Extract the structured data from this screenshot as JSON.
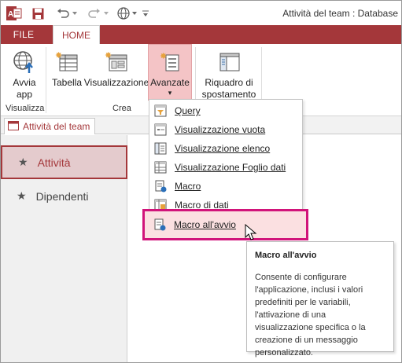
{
  "window": {
    "title": "Attività del team : Database"
  },
  "qat": {
    "app_icon_letter": "A",
    "undo_icon": "undo-icon",
    "redo_icon": "redo-icon",
    "web_icon": "globe-icon",
    "customize_icon": "caret-down-icon"
  },
  "tabs": {
    "file": "FILE",
    "home": "HOME"
  },
  "ribbon": {
    "launch_app": {
      "line1": "Avvia",
      "line2": "app"
    },
    "group_visualizza": "Visualizza",
    "table": "Tabella",
    "view": "Visualizzazione",
    "advanced": "Avanzate",
    "advanced_arrow": "▾",
    "group_crea": "Crea",
    "nav_pane": {
      "line1": "Riquadro di",
      "line2": "spostamento"
    }
  },
  "doc_tab": {
    "label": "Attività del team"
  },
  "nav": {
    "items": [
      {
        "label": "Attività",
        "star": "★"
      },
      {
        "label": "Dipendenti",
        "star": "★"
      }
    ]
  },
  "menu": {
    "items": [
      {
        "label": "Query",
        "icon": "query-icon"
      },
      {
        "label": "Visualizzazione vuota",
        "icon": "blank-view-icon"
      },
      {
        "label": "Visualizzazione elenco",
        "icon": "list-view-icon"
      },
      {
        "label": "Visualizzazione Foglio dati",
        "icon": "datasheet-view-icon"
      },
      {
        "label": "Macro",
        "icon": "macro-icon"
      },
      {
        "label": "Macro di dati",
        "icon": "data-macro-icon"
      },
      {
        "label": "Macro all'avvio",
        "icon": "startup-macro-icon"
      }
    ]
  },
  "tooltip": {
    "title": "Macro all'avvio",
    "body": "Consente di configurare l'applicazione, inclusi i valori predefiniti per le variabili, l'attivazione di una visualizzazione specifica o la creazione di un messaggio personalizzato."
  },
  "colors": {
    "accent": "#a4373a",
    "highlight_box": "#d1147a",
    "hover": "#fbe0e1"
  }
}
